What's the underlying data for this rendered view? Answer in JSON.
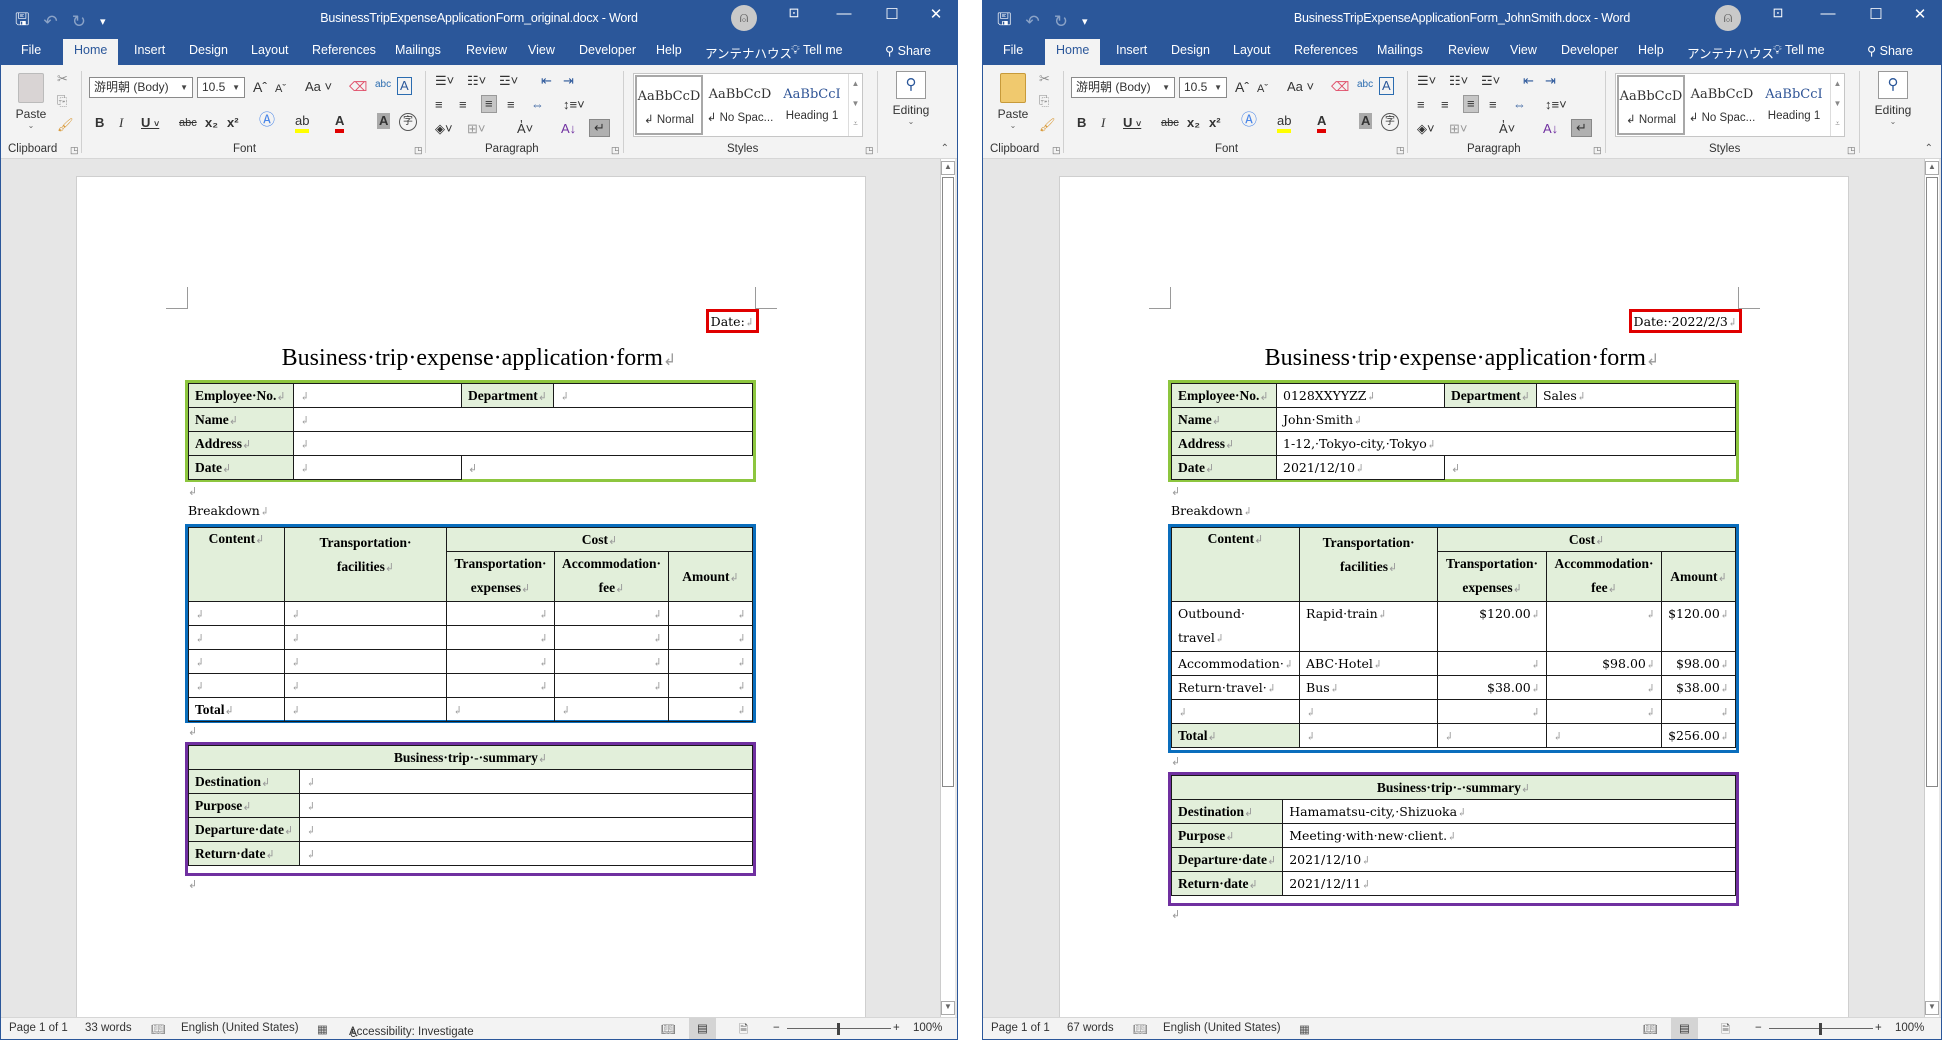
{
  "common": {
    "tabs": [
      "File",
      "Home",
      "Insert",
      "Design",
      "Layout",
      "References",
      "Mailings",
      "Review",
      "View",
      "Developer",
      "Help",
      "アンテナハウス"
    ],
    "active_tab": "Home",
    "tell_me": "Tell me",
    "share": "Share",
    "font_name": "游明朝 (Body)",
    "font_size": "10.5",
    "paste_label": "Paste",
    "group_labels": {
      "clipboard": "Clipboard",
      "font": "Font",
      "paragraph": "Paragraph",
      "styles": "Styles"
    },
    "styles": [
      {
        "preview": "AaBbCcD",
        "name": "↲ Normal"
      },
      {
        "preview": "AaBbCcD",
        "name": "↲ No Spac..."
      },
      {
        "preview": "AaBbCcI",
        "name": "Heading 1"
      }
    ],
    "editing_label": "Editing",
    "language": "English (United States)",
    "zoom_level": "100%",
    "doc_title": "Business·trip·expense·application·form",
    "breakdown_label": "Breakdown",
    "info_labels": {
      "employee_no": "Employee·No.",
      "department": "Department",
      "name": "Name",
      "address": "Address",
      "date": "Date"
    },
    "breakdown_headers": {
      "content": "Content",
      "transport_facilities_1": "Transportation·",
      "transport_facilities_2": "facilities",
      "cost": "Cost",
      "transport_expenses_1": "Transportation·",
      "transport_expenses_2": "expenses",
      "accommodation_fee_1": "Accommodation·",
      "accommodation_fee_2": "fee",
      "amount": "Amount",
      "total": "Total"
    },
    "summary_headers": {
      "title": "Business·trip·-·summary",
      "destination": "Destination",
      "purpose": "Purpose",
      "departure_date": "Departure·date",
      "return_date": "Return·date"
    },
    "colors": {
      "title_bar": "#2b579a",
      "header_fill": "#e2efda",
      "date_highlight": "#e00000",
      "info_highlight": "#8dc63f",
      "breakdown_highlight": "#0a6ebd",
      "summary_highlight": "#7030a0"
    }
  },
  "left": {
    "window_title": "BusinessTripExpenseApplicationForm_original.docx  -  Word",
    "page_status": "Page 1 of 1",
    "word_count": "33 words",
    "accessibility": "Accessibility: Investigate",
    "date_text": "Date:",
    "info": {
      "employee_no": "",
      "department": "",
      "name": "",
      "address": "",
      "date": ""
    },
    "breakdown_rows": [
      {
        "content": "",
        "facility": "",
        "transport": "",
        "accommodation": "",
        "amount": ""
      },
      {
        "content": "",
        "facility": "",
        "transport": "",
        "accommodation": "",
        "amount": ""
      },
      {
        "content": "",
        "facility": "",
        "transport": "",
        "accommodation": "",
        "amount": ""
      },
      {
        "content": "",
        "facility": "",
        "transport": "",
        "accommodation": "",
        "amount": ""
      }
    ],
    "total": {
      "facility": "",
      "transport": "",
      "accommodation": "",
      "amount": ""
    },
    "summary": {
      "destination": "",
      "purpose": "",
      "departure_date": "",
      "return_date": ""
    }
  },
  "right": {
    "window_title": "BusinessTripExpenseApplicationForm_JohnSmith.docx  -  Word",
    "page_status": "Page 1 of 1",
    "word_count": "67 words",
    "date_text": "Date:·2022/2/3",
    "info": {
      "employee_no": "0128XXYYZZ",
      "department": "Sales",
      "name": "John·Smith",
      "address": "1-12,·Tokyo-city,·Tokyo",
      "date": "2021/12/10"
    },
    "breakdown_rows": [
      {
        "content": "Outbound·",
        "content2": "travel",
        "facility": "Rapid·train",
        "transport": "$120.00",
        "accommodation": "",
        "amount": "$120.00"
      },
      {
        "content": "Accommodation·",
        "facility": "ABC·Hotel",
        "transport": "",
        "accommodation": "$98.00",
        "amount": "$98.00"
      },
      {
        "content": "Return·travel·",
        "facility": "Bus",
        "transport": "$38.00",
        "accommodation": "",
        "amount": "$38.00"
      },
      {
        "content": "",
        "facility": "",
        "transport": "",
        "accommodation": "",
        "amount": ""
      }
    ],
    "total": {
      "facility": "",
      "transport": "",
      "accommodation": "",
      "amount": "$256.00"
    },
    "summary": {
      "destination": "Hamamatsu-city,·Shizuoka",
      "purpose": "Meeting·with·new·client.",
      "departure_date": "2021/12/10",
      "return_date": "2021/12/11"
    }
  }
}
